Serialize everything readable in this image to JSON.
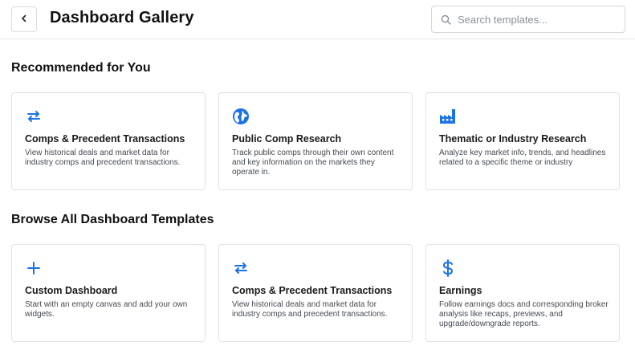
{
  "header": {
    "title": "Dashboard Gallery",
    "search_placeholder": "Search templates..."
  },
  "colors": {
    "accent": "#1a73e8"
  },
  "recommended": {
    "heading": "Recommended for You",
    "cards": [
      {
        "icon": "swap-arrows-icon",
        "title": "Comps & Precedent Transactions",
        "desc": "View historical deals and market data for industry comps and precedent transactions."
      },
      {
        "icon": "globe-icon",
        "title": "Public Comp Research",
        "desc": "Track public comps through their own content and key information on the markets they operate in."
      },
      {
        "icon": "factory-icon",
        "title": "Thematic or Industry Research",
        "desc": "Analyze key market info, trends, and headlines related to a specific theme or industry"
      }
    ]
  },
  "browse": {
    "heading": "Browse All Dashboard Templates",
    "cards": [
      {
        "icon": "plus-icon",
        "title": "Custom Dashboard",
        "desc": "Start with an empty canvas and add your own widgets."
      },
      {
        "icon": "swap-arrows-icon",
        "title": "Comps & Precedent Transactions",
        "desc": "View historical deals and market data for industry comps and precedent transactions."
      },
      {
        "icon": "dollar-icon",
        "title": "Earnings",
        "desc": "Follow earnings docs and corresponding broker analysis like recaps, previews, and upgrade/downgrade reports."
      }
    ]
  }
}
